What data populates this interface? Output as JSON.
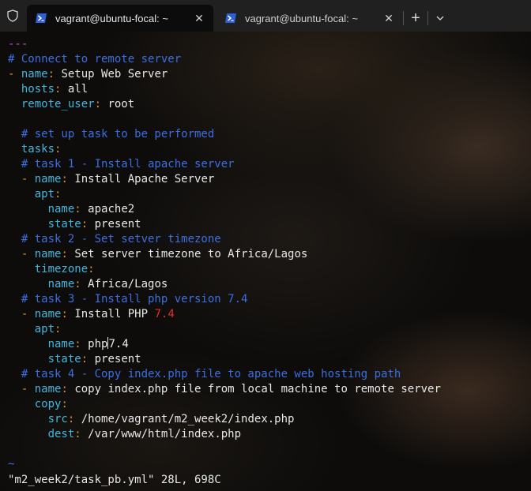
{
  "titlebar": {
    "tabs": [
      {
        "label": "vagrant@ubuntu-focal: ~",
        "icon": "powershell-icon",
        "active": true
      },
      {
        "label": "vagrant@ubuntu-focal: ~",
        "icon": "powershell-icon",
        "active": false
      }
    ],
    "new_tab_icon": "plus-icon",
    "dropdown_icon": "chevron-down-icon",
    "shield_icon": "shield-icon"
  },
  "editor": {
    "lines": [
      {
        "indent": "",
        "dash": "",
        "key": "",
        "value": "",
        "comment": "",
        "docstart": "---"
      },
      {
        "comment": "# Connect to remote server"
      },
      {
        "indent": "",
        "dash": "- ",
        "key": "name",
        "value": "Setup Web Server"
      },
      {
        "indent": "  ",
        "key": "hosts",
        "value": "all"
      },
      {
        "indent": "  ",
        "key": "remote_user",
        "value": "root"
      },
      {
        "blank": true
      },
      {
        "indent": "  ",
        "comment": "# set up task to be performed"
      },
      {
        "indent": "  ",
        "key": "tasks",
        "value": ""
      },
      {
        "indent": "  ",
        "comment": "# task 1 - Install apache server"
      },
      {
        "indent": "  ",
        "dash": "- ",
        "key": "name",
        "value": "Install Apache Server"
      },
      {
        "indent": "    ",
        "key": "apt",
        "value": ""
      },
      {
        "indent": "      ",
        "key": "name",
        "value": "apache2"
      },
      {
        "indent": "      ",
        "key": "state",
        "value": "present"
      },
      {
        "indent": "  ",
        "comment": "# task 2 - Set setver timezone"
      },
      {
        "indent": "  ",
        "dash": "- ",
        "key": "name",
        "value": "Set server timezone to Africa/Lagos"
      },
      {
        "indent": "    ",
        "key": "timezone",
        "value": ""
      },
      {
        "indent": "      ",
        "key": "name",
        "value": "Africa/Lagos"
      },
      {
        "indent": "  ",
        "comment": "# task 3 - Install php version 7.4"
      },
      {
        "indent": "  ",
        "dash": "- ",
        "key": "name",
        "value": "Install PHP ",
        "num": "7.4"
      },
      {
        "indent": "    ",
        "key": "apt",
        "value": ""
      },
      {
        "indent": "      ",
        "key": "name",
        "value": "php",
        "cursor": true,
        "value2": "7.4"
      },
      {
        "indent": "      ",
        "key": "state",
        "value": "present"
      },
      {
        "indent": "  ",
        "comment": "# task 4 - Copy index.php file to apache web hosting path"
      },
      {
        "indent": "  ",
        "dash": "- ",
        "key": "name",
        "value": "copy index.php file from local machine to remote server"
      },
      {
        "indent": "    ",
        "key": "copy",
        "value": ""
      },
      {
        "indent": "      ",
        "key": "src",
        "value": "/home/vagrant/m2_week2/index.php"
      },
      {
        "indent": "      ",
        "key": "dest",
        "value": "/var/www/html/index.php"
      },
      {
        "blank": true
      },
      {
        "tilde": "~"
      }
    ],
    "status": "\"m2_week2/task_pb.yml\" 28L, 698C"
  },
  "colors": {
    "comment": "#3b6fe0",
    "key": "#43b6dc",
    "punct": "#d49a3a",
    "number": "#e0302a",
    "docstart": "#b05ad8"
  }
}
